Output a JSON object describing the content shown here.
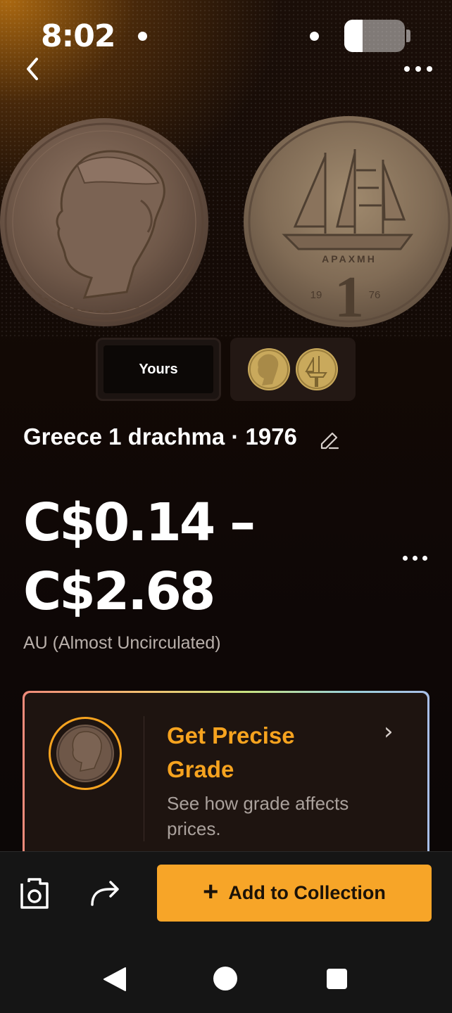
{
  "status_bar": {
    "time": "8:02",
    "battery_level": 0.3
  },
  "header": {
    "back_icon": "chevron-left-icon",
    "more_icon": "more-horizontal-icon"
  },
  "coin": {
    "obverse_icon": "coin-obverse-portrait",
    "reverse_icon": "coin-reverse-ship",
    "reverse_legend": "ΑΡΑΧΜΗ",
    "reverse_denomination": "1",
    "reverse_year_left": "19",
    "reverse_year_right": "76"
  },
  "image_tabs": {
    "yours_label": "Yours"
  },
  "title": {
    "text": "Greece 1 drachma · 1976",
    "edit_icon": "pencil-icon"
  },
  "price": {
    "line1": "C$0.14 –",
    "line2": "C$2.68",
    "grade": "AU (Almost Uncirculated)"
  },
  "grade_card": {
    "title": "Get Precise Grade",
    "subtitle": "See how grade affects prices.",
    "chevron": "›",
    "accent": "#f6a31f"
  },
  "actions": {
    "camera_icon": "camera-icon",
    "share_icon": "share-arrow-icon",
    "add_plus": "+",
    "add_label": "Add to Collection",
    "button_color": "#f7a528"
  },
  "android_nav": {
    "back": "nav-back-icon",
    "home": "nav-home-icon",
    "recent": "nav-recent-icon"
  }
}
